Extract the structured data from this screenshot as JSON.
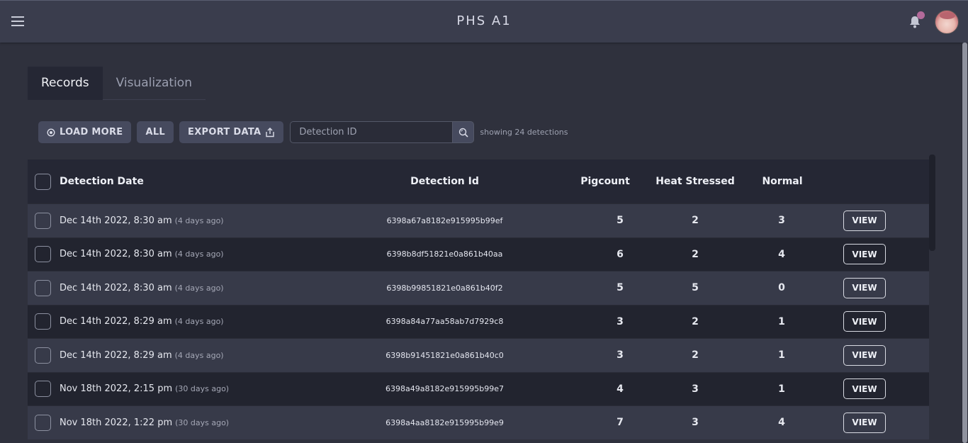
{
  "app": {
    "title": "PHS A1",
    "menu_icon": "hamburger-menu-icon",
    "bell_icon": "bell-icon",
    "avatar_icon": "user-avatar"
  },
  "tabs": [
    {
      "label": "Records",
      "active": true
    },
    {
      "label": "Visualization",
      "active": false
    }
  ],
  "toolbar": {
    "load_more_label": "LOAD MORE",
    "all_label": "ALL",
    "export_label": "EXPORT DATA",
    "search_placeholder": "Detection ID",
    "search_value": "",
    "showing_text": "showing 24 detections"
  },
  "table": {
    "headers": {
      "date": "Detection Date",
      "id": "Detection Id",
      "pigcount": "Pigcount",
      "heat": "Heat Stressed",
      "normal": "Normal"
    },
    "view_label": "VIEW",
    "rows": [
      {
        "date": "Dec 14th 2022, 8:30 am",
        "ago": "(4 days ago)",
        "id": "6398a67a8182e915995b99ef",
        "pigcount": "5",
        "heat": "2",
        "normal": "3"
      },
      {
        "date": "Dec 14th 2022, 8:30 am",
        "ago": "(4 days ago)",
        "id": "6398b8df51821e0a861b40aa",
        "pigcount": "6",
        "heat": "2",
        "normal": "4"
      },
      {
        "date": "Dec 14th 2022, 8:30 am",
        "ago": "(4 days ago)",
        "id": "6398b99851821e0a861b40f2",
        "pigcount": "5",
        "heat": "5",
        "normal": "0"
      },
      {
        "date": "Dec 14th 2022, 8:29 am",
        "ago": "(4 days ago)",
        "id": "6398a84a77aa58ab7d7929c8",
        "pigcount": "3",
        "heat": "2",
        "normal": "1"
      },
      {
        "date": "Dec 14th 2022, 8:29 am",
        "ago": "(4 days ago)",
        "id": "6398b91451821e0a861b40c0",
        "pigcount": "3",
        "heat": "2",
        "normal": "1"
      },
      {
        "date": "Nov 18th 2022, 2:15 pm",
        "ago": "(30 days ago)",
        "id": "6398a49a8182e915995b99e7",
        "pigcount": "4",
        "heat": "3",
        "normal": "1"
      },
      {
        "date": "Nov 18th 2022, 1:22 pm",
        "ago": "(30 days ago)",
        "id": "6398a4aa8182e915995b99e9",
        "pigcount": "7",
        "heat": "3",
        "normal": "4"
      }
    ]
  },
  "colors": {
    "background": "#2f313d",
    "appbar": "#3a3d4d",
    "header_row": "#252734",
    "row_light": "#373a49",
    "row_dark": "#22242f",
    "notification_dot": "#b36a9a"
  }
}
